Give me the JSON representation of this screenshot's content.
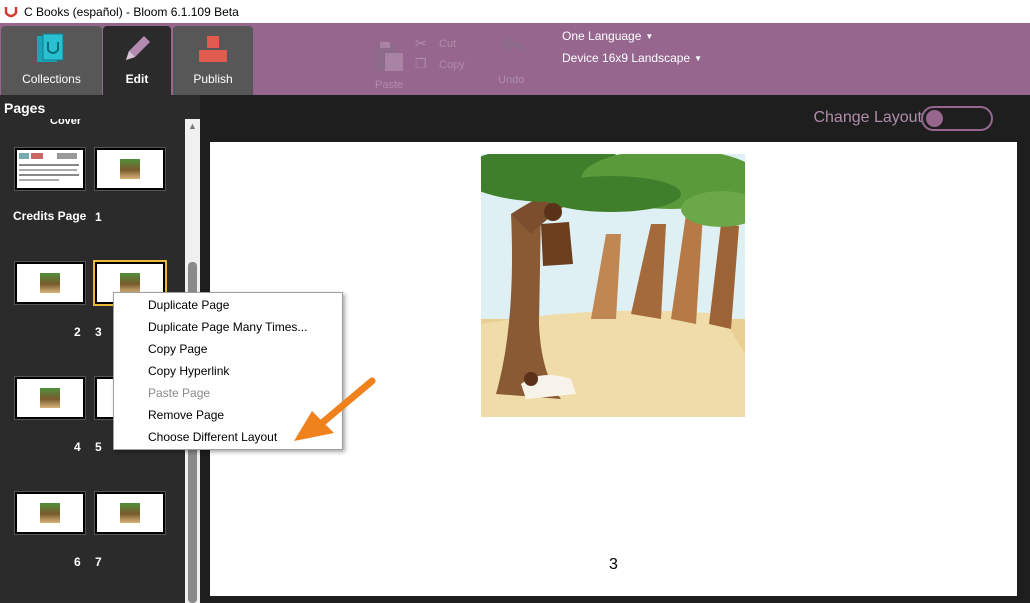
{
  "window": {
    "title": "C Books (español) - Bloom 6.1.109 Beta"
  },
  "tabs": {
    "collections": "Collections",
    "edit": "Edit",
    "publish": "Publish"
  },
  "toolbar": {
    "paste": "Paste",
    "cut": "Cut",
    "copy": "Copy",
    "undo": "Undo",
    "language_dropdown": "One Language",
    "layout_dropdown": "Device 16x9 Landscape"
  },
  "sidebar": {
    "title": "Pages",
    "cover_label": "Cover",
    "credits_label": "Credits Page",
    "page_numbers": [
      "1",
      "2",
      "3",
      "4",
      "5",
      "6",
      "7"
    ]
  },
  "editor": {
    "change_layout": "Change Layout",
    "page_number": "3"
  },
  "context_menu": {
    "items": [
      {
        "label": "Duplicate Page",
        "enabled": true
      },
      {
        "label": "Duplicate Page Many Times...",
        "enabled": true
      },
      {
        "label": "Copy Page",
        "enabled": true
      },
      {
        "label": "Copy Hyperlink",
        "enabled": true
      },
      {
        "label": "Paste Page",
        "enabled": false
      },
      {
        "label": "Remove Page",
        "enabled": true
      },
      {
        "label": "Choose Different Layout",
        "enabled": true
      }
    ]
  },
  "colors": {
    "accent": "#96668f",
    "selection": "#e8b93a",
    "arrow": "#f0821e"
  }
}
